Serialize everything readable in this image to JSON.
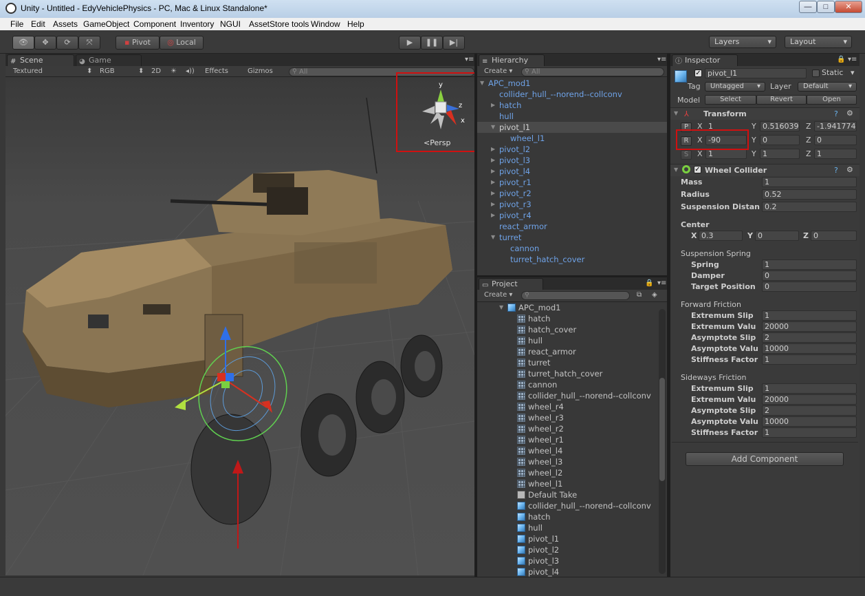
{
  "window": {
    "title": "Unity - Untitled - EdyVehiclePhysics - PC, Mac & Linux Standalone*",
    "min": "—",
    "max": "□",
    "close": "✕"
  },
  "menu": [
    "File",
    "Edit",
    "Assets",
    "GameObject",
    "Component",
    "Inventory",
    "NGUI",
    "AssetStore tools",
    "Window",
    "Help"
  ],
  "toolbar": {
    "pivot": "Pivot",
    "local": "Local",
    "layers": "Layers",
    "layout": "Layout"
  },
  "scene": {
    "tab_scene": "Scene",
    "tab_game": "Game",
    "render_mode": "Textured",
    "color_mode": "RGB",
    "mode_2d": "2D",
    "effects": "Effects",
    "gizmos": "Gizmos",
    "search_placeholder": "All",
    "axis_y": "y",
    "axis_z": "z",
    "axis_x": "x",
    "persp": "Persp"
  },
  "hierarchy": {
    "tab": "Hierarchy",
    "create": "Create",
    "search_placeholder": "All",
    "items": [
      {
        "label": "APC_mod1",
        "indent": 0,
        "arrow": "▼"
      },
      {
        "label": "collider_hull_--norend--collconv",
        "indent": 1,
        "arrow": ""
      },
      {
        "label": "hatch",
        "indent": 1,
        "arrow": "▶"
      },
      {
        "label": "hull",
        "indent": 1,
        "arrow": ""
      },
      {
        "label": "pivot_l1",
        "indent": 1,
        "arrow": "▼",
        "selected": true
      },
      {
        "label": "wheel_l1",
        "indent": 2,
        "arrow": ""
      },
      {
        "label": "pivot_l2",
        "indent": 1,
        "arrow": "▶"
      },
      {
        "label": "pivot_l3",
        "indent": 1,
        "arrow": "▶"
      },
      {
        "label": "pivot_l4",
        "indent": 1,
        "arrow": "▶"
      },
      {
        "label": "pivot_r1",
        "indent": 1,
        "arrow": "▶"
      },
      {
        "label": "pivot_r2",
        "indent": 1,
        "arrow": "▶"
      },
      {
        "label": "pivot_r3",
        "indent": 1,
        "arrow": "▶"
      },
      {
        "label": "pivot_r4",
        "indent": 1,
        "arrow": "▶"
      },
      {
        "label": "react_armor",
        "indent": 1,
        "arrow": ""
      },
      {
        "label": "turret",
        "indent": 1,
        "arrow": "▼"
      },
      {
        "label": "cannon",
        "indent": 2,
        "arrow": ""
      },
      {
        "label": "turret_hatch_cover",
        "indent": 2,
        "arrow": ""
      }
    ]
  },
  "project": {
    "tab": "Project",
    "create": "Create",
    "root": "APC_mod1",
    "items": [
      {
        "label": "hatch",
        "icon": "mesh-icon"
      },
      {
        "label": "hatch_cover",
        "icon": "mesh-icon"
      },
      {
        "label": "hull",
        "icon": "mesh-icon"
      },
      {
        "label": "react_armor",
        "icon": "mesh-icon"
      },
      {
        "label": "turret",
        "icon": "mesh-icon"
      },
      {
        "label": "turret_hatch_cover",
        "icon": "mesh-icon"
      },
      {
        "label": "cannon",
        "icon": "mesh-icon"
      },
      {
        "label": "collider_hull_--norend--collconv",
        "icon": "mesh-icon"
      },
      {
        "label": "wheel_r4",
        "icon": "mesh-icon"
      },
      {
        "label": "wheel_r3",
        "icon": "mesh-icon"
      },
      {
        "label": "wheel_r2",
        "icon": "mesh-icon"
      },
      {
        "label": "wheel_r1",
        "icon": "mesh-icon"
      },
      {
        "label": "wheel_l4",
        "icon": "mesh-icon"
      },
      {
        "label": "wheel_l3",
        "icon": "mesh-icon"
      },
      {
        "label": "wheel_l2",
        "icon": "mesh-icon"
      },
      {
        "label": "wheel_l1",
        "icon": "mesh-icon"
      },
      {
        "label": "Default Take",
        "icon": "animation-take-icon"
      },
      {
        "label": "collider_hull_--norend--collconv",
        "icon": "gameobject-icon"
      },
      {
        "label": "hatch",
        "icon": "gameobject-icon"
      },
      {
        "label": "hull",
        "icon": "gameobject-icon"
      },
      {
        "label": "pivot_l1",
        "icon": "gameobject-icon"
      },
      {
        "label": "pivot_l2",
        "icon": "gameobject-icon"
      },
      {
        "label": "pivot_l3",
        "icon": "gameobject-icon"
      },
      {
        "label": "pivot_l4",
        "icon": "gameobject-icon"
      }
    ]
  },
  "inspector": {
    "tab": "Inspector",
    "name": "pivot_l1",
    "static": "Static",
    "tag_label": "Tag",
    "tag": "Untagged",
    "layer_label": "Layer",
    "layer": "Default",
    "model_label": "Model",
    "select": "Select",
    "revert": "Revert",
    "open": "Open",
    "transform": {
      "title": "Transform",
      "p": {
        "btn": "P",
        "x": "1",
        "y": "0.516039",
        "z": "-1.941774"
      },
      "r": {
        "btn": "R",
        "x": "-90",
        "y": "0",
        "z": "0"
      },
      "s": {
        "btn": "S",
        "x": "1",
        "y": "1",
        "z": "1"
      },
      "xl": "X",
      "yl": "Y",
      "zl": "Z"
    },
    "wheel": {
      "title": "Wheel Collider",
      "mass_l": "Mass",
      "mass": "1",
      "radius_l": "Radius",
      "radius": "0.52",
      "susp_dist_l": "Suspension Distan",
      "susp_dist": "0.2",
      "center_l": "Center",
      "cx": "0.3",
      "cy": "0",
      "cz": "0",
      "spring_hdr": "Suspension Spring",
      "spring_l": "Spring",
      "spring": "1",
      "damper_l": "Damper",
      "damper": "0",
      "target_l": "Target Position",
      "target": "0",
      "ff_hdr": "Forward Friction",
      "ff": [
        {
          "l": "Extremum Slip",
          "v": "1"
        },
        {
          "l": "Extremum Valu",
          "v": "20000"
        },
        {
          "l": "Asymptote Slip",
          "v": "2"
        },
        {
          "l": "Asymptote Valu",
          "v": "10000"
        },
        {
          "l": "Stiffness Factor",
          "v": "1"
        }
      ],
      "sf_hdr": "Sideways Friction",
      "sf": [
        {
          "l": "Extremum Slip",
          "v": "1"
        },
        {
          "l": "Extremum Valu",
          "v": "20000"
        },
        {
          "l": "Asymptote Slip",
          "v": "2"
        },
        {
          "l": "Asymptote Valu",
          "v": "10000"
        },
        {
          "l": "Stiffness Factor",
          "v": "1"
        }
      ]
    },
    "add_component": "Add Component"
  }
}
